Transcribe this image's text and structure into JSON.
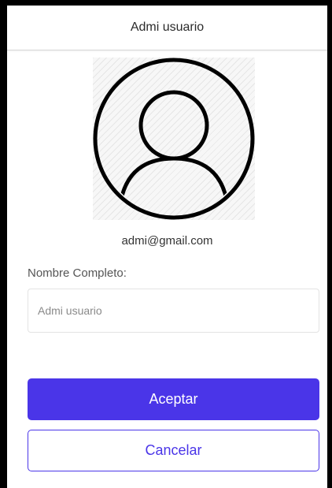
{
  "app_bar": {
    "title": "Admi usuario"
  },
  "profile": {
    "avatar_icon": "user-avatar-icon",
    "email": "admi@gmail.com"
  },
  "form": {
    "name_label": "Nombre Completo:",
    "name_value": "Admi usuario",
    "name_placeholder": ""
  },
  "actions": {
    "accept_label": "Aceptar",
    "cancel_label": "Cancelar"
  },
  "colors": {
    "accent": "#4a35e8",
    "frame": "#000000"
  }
}
